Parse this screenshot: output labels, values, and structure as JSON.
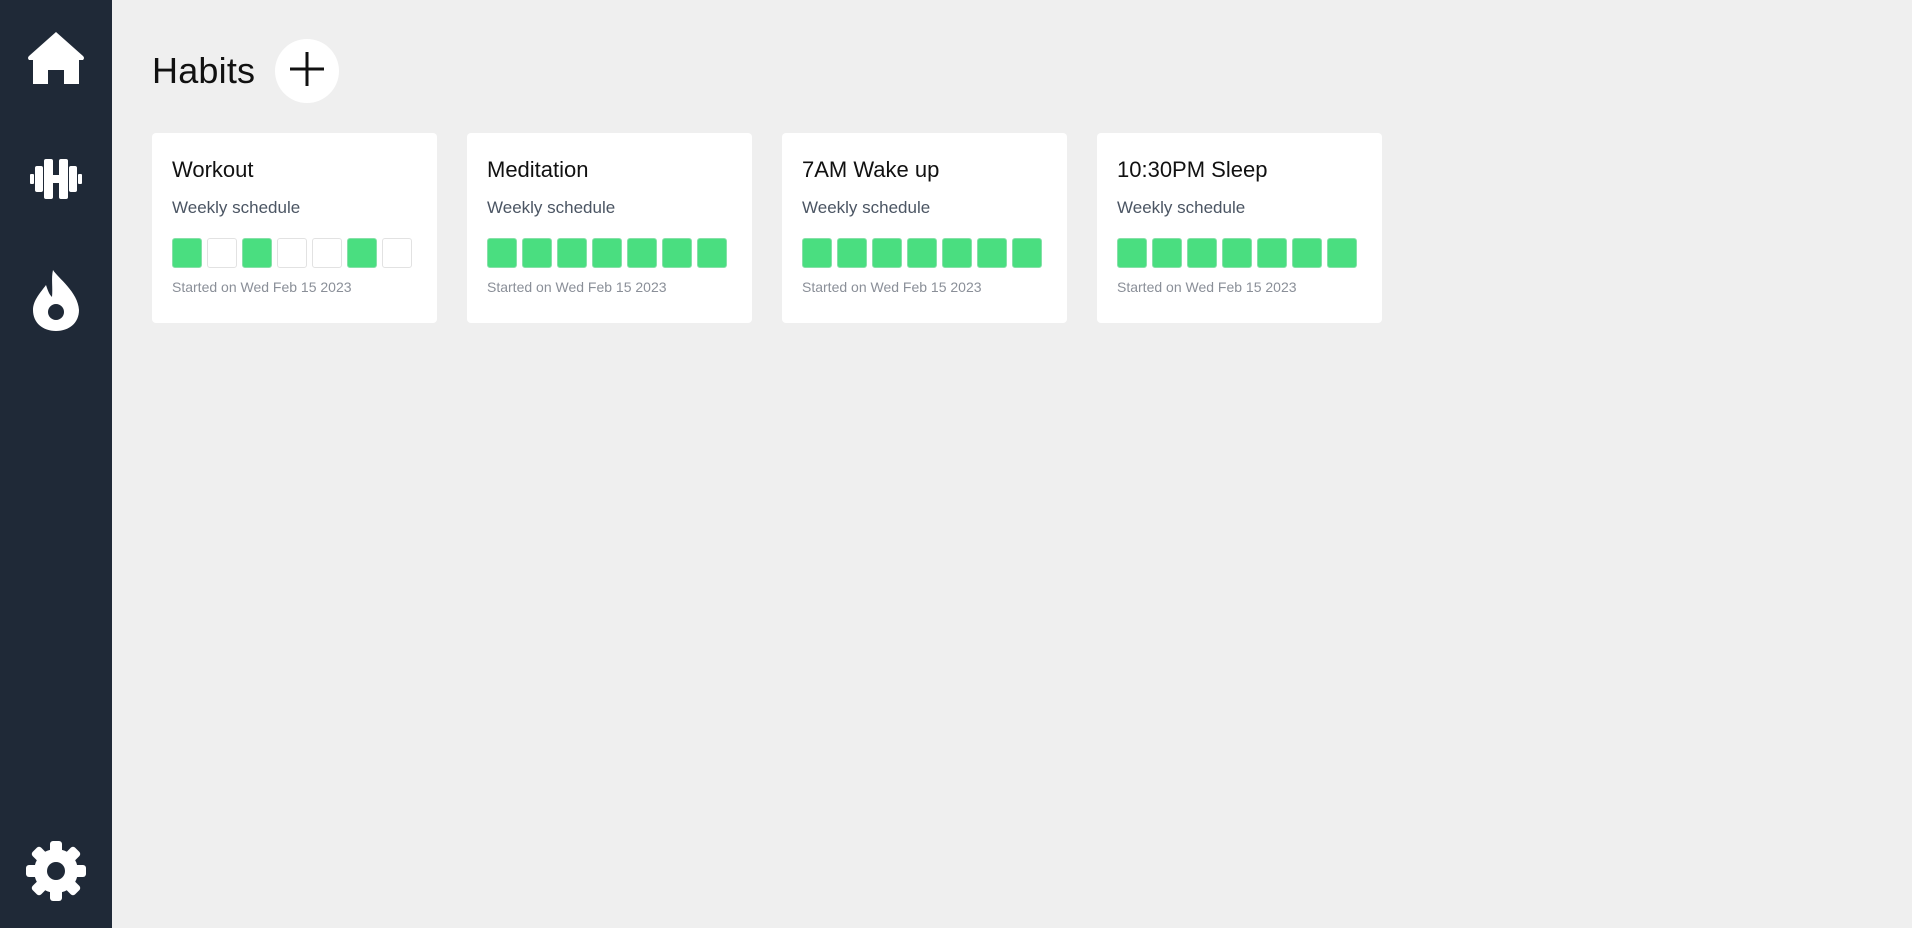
{
  "page": {
    "title": "Habits"
  },
  "sidebar": {
    "items": [
      {
        "name": "home",
        "icon": "home-icon"
      },
      {
        "name": "habits",
        "icon": "dumbbell-icon"
      },
      {
        "name": "streaks",
        "icon": "flame-icon"
      },
      {
        "name": "settings",
        "icon": "gear-icon"
      }
    ]
  },
  "add_button": {
    "icon": "plus-icon"
  },
  "colors": {
    "sidebar_bg": "#1f2937",
    "page_bg": "#efefef",
    "done": "#4ade80",
    "not_done": "#ffffff"
  },
  "habits": [
    {
      "title": "Workout",
      "subtitle": "Weekly schedule",
      "days": [
        true,
        false,
        true,
        false,
        false,
        true,
        false
      ],
      "started": "Started on Wed Feb 15 2023"
    },
    {
      "title": "Meditation",
      "subtitle": "Weekly schedule",
      "days": [
        true,
        true,
        true,
        true,
        true,
        true,
        true
      ],
      "started": "Started on Wed Feb 15 2023"
    },
    {
      "title": "7AM Wake up",
      "subtitle": "Weekly schedule",
      "days": [
        true,
        true,
        true,
        true,
        true,
        true,
        true
      ],
      "started": "Started on Wed Feb 15 2023"
    },
    {
      "title": "10:30PM Sleep",
      "subtitle": "Weekly schedule",
      "days": [
        true,
        true,
        true,
        true,
        true,
        true,
        true
      ],
      "started": "Started on Wed Feb 15 2023"
    }
  ]
}
